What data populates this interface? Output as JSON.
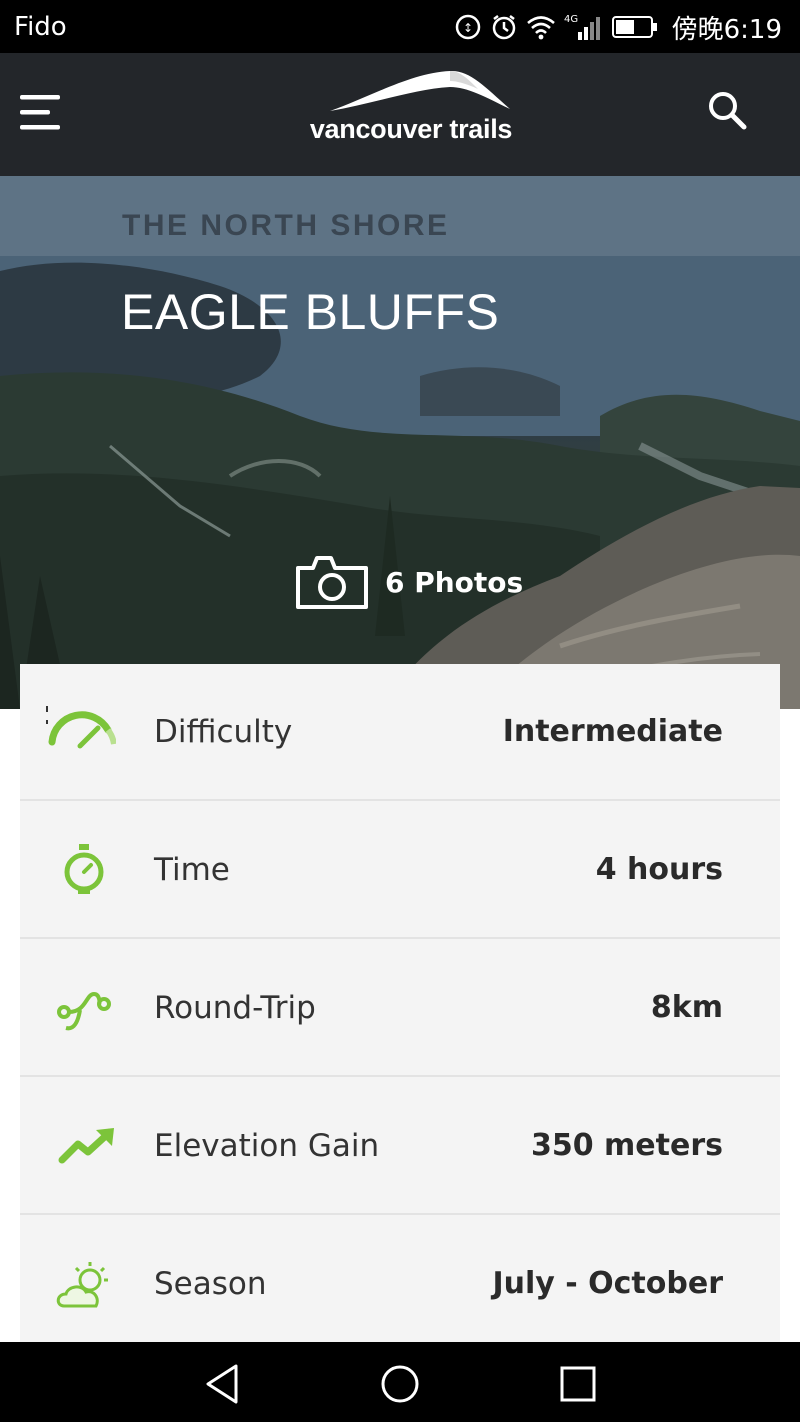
{
  "status_bar": {
    "carrier": "Fido",
    "time": "傍晚6:19",
    "network": "4G"
  },
  "header": {
    "logo_text": "vancouver trails",
    "menu_icon": "hamburger-menu-icon",
    "search_icon": "search-icon"
  },
  "hero": {
    "region": "THE NORTH SHORE",
    "title": "EAGLE BLUFFS",
    "photos_label": "6 Photos",
    "photos_icon": "camera-icon"
  },
  "details": [
    {
      "icon": "gauge-icon",
      "label": "Difficulty",
      "value": "Intermediate"
    },
    {
      "icon": "stopwatch-icon",
      "label": "Time",
      "value": "4 hours"
    },
    {
      "icon": "route-icon",
      "label": "Round-Trip",
      "value": "8km"
    },
    {
      "icon": "trend-up-icon",
      "label": "Elevation Gain",
      "value": "350 meters"
    },
    {
      "icon": "sun-cloud-icon",
      "label": "Season",
      "value": "July - October"
    }
  ],
  "colors": {
    "accent_green": "#7cc43a",
    "header_bg": "#23262a",
    "card_bg": "#f4f4f4"
  },
  "nav": {
    "back_icon": "back-triangle-icon",
    "home_icon": "home-circle-icon",
    "recents_icon": "recents-square-icon"
  }
}
